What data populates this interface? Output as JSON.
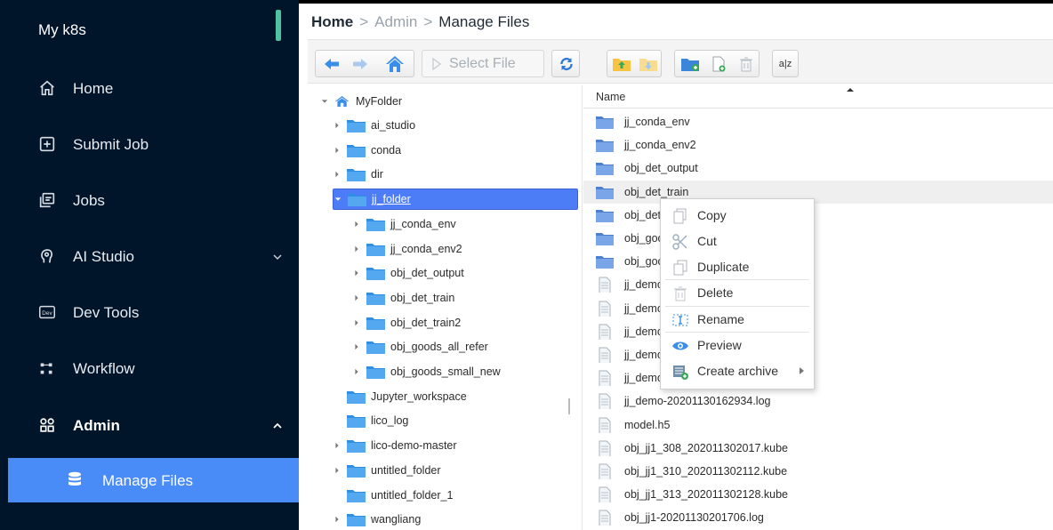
{
  "app": {
    "title": "My k8s",
    "accent": "#4fc3a1",
    "sidebar_bg": "#001529",
    "active_bg": "#4a8cf7"
  },
  "sidebar": {
    "items": [
      {
        "label": "Home",
        "icon": "home-icon"
      },
      {
        "label": "Submit Job",
        "icon": "plus-square-icon"
      },
      {
        "label": "Jobs",
        "icon": "jobs-icon"
      },
      {
        "label": "AI Studio",
        "icon": "ai-studio-icon"
      },
      {
        "label": "Dev Tools",
        "icon": "dev-icon"
      },
      {
        "label": "Workflow",
        "icon": "workflow-icon"
      },
      {
        "label": "Admin",
        "icon": "apps-icon"
      }
    ],
    "sub_item": {
      "label": "Manage Files",
      "icon": "database-icon"
    }
  },
  "breadcrumb": {
    "home": "Home",
    "sep": ">",
    "admin": "Admin",
    "current": "Manage Files"
  },
  "toolbar": {
    "select_file": "Select File",
    "sort_label": "a|z"
  },
  "tree": {
    "root": "MyFolder",
    "items": [
      "ai_studio",
      "conda",
      "dir",
      "jj_folder",
      "jj_conda_env",
      "jj_conda_env2",
      "obj_det_output",
      "obj_det_train",
      "obj_det_train2",
      "obj_goods_all_refer",
      "obj_goods_small_new",
      "Jupyter_workspace",
      "lico_log",
      "lico-demo-master",
      "untitled_folder",
      "untitled_folder_1",
      "wangliang"
    ]
  },
  "list": {
    "header": "Name",
    "items": [
      "jj_conda_env",
      "jj_conda_env2",
      "obj_det_output",
      "obj_det_train",
      "obj_det",
      "obj_goo",
      "obj_goo",
      "jj_demo",
      "jj_demo",
      "jj_demo",
      "jj_demo",
      "jj_demo",
      "jj_demo-20201130162934.log",
      "model.h5",
      "obj_jj1_308_202011302017.kube",
      "obj_jj1_310_202011302112.kube",
      "obj_jj1_313_202011302128.kube",
      "obj_jj1-20201130201706.log"
    ]
  },
  "context_menu": {
    "items": [
      "Copy",
      "Cut",
      "Duplicate",
      "Delete",
      "Rename",
      "Preview",
      "Create archive"
    ]
  }
}
